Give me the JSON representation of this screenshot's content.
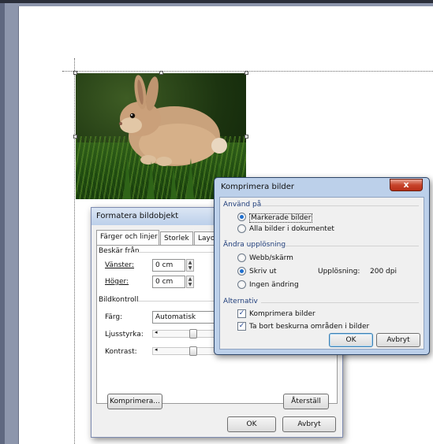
{
  "photo": {
    "subject": "rabbit in grass"
  },
  "format_dialog": {
    "title": "Formatera bildobjekt",
    "tabs": [
      "Färger och linjer",
      "Storlek",
      "Layout"
    ],
    "crop_group": "Beskär från",
    "left_label": "Vänster:",
    "left_value": "0 cm",
    "right_label": "Höger:",
    "right_value": "0 cm",
    "image_control_group": "Bildkontroll",
    "color_label": "Färg:",
    "color_value": "Automatisk",
    "brightness_label": "Ljusstyrka:",
    "contrast_label": "Kontrast:",
    "compress_button": "Komprimera...",
    "reset_button": "Återställ",
    "ok_button": "OK",
    "cancel_button": "Avbryt"
  },
  "compress_dialog": {
    "title": "Komprimera bilder",
    "close_label": "x",
    "apply_group": "Använd på",
    "apply_options": [
      "Markerade bilder",
      "Alla bilder i dokumentet"
    ],
    "resolution_group": "Ändra upplösning",
    "resolution_options": [
      "Webb/skärm",
      "Skriv ut",
      "Ingen ändring"
    ],
    "resolution_label": "Upplösning:",
    "resolution_value": "200 dpi",
    "options_group": "Alternativ",
    "option_compress": "Komprimera bilder",
    "option_delete_cropped": "Ta bort beskurna områden i bilder",
    "ok_button": "OK",
    "cancel_button": "Avbryt"
  },
  "colors": {
    "title_bar_front": "#bcd0ea",
    "close_red": "#c7442b",
    "radio_selected": "#1f6fcf"
  }
}
